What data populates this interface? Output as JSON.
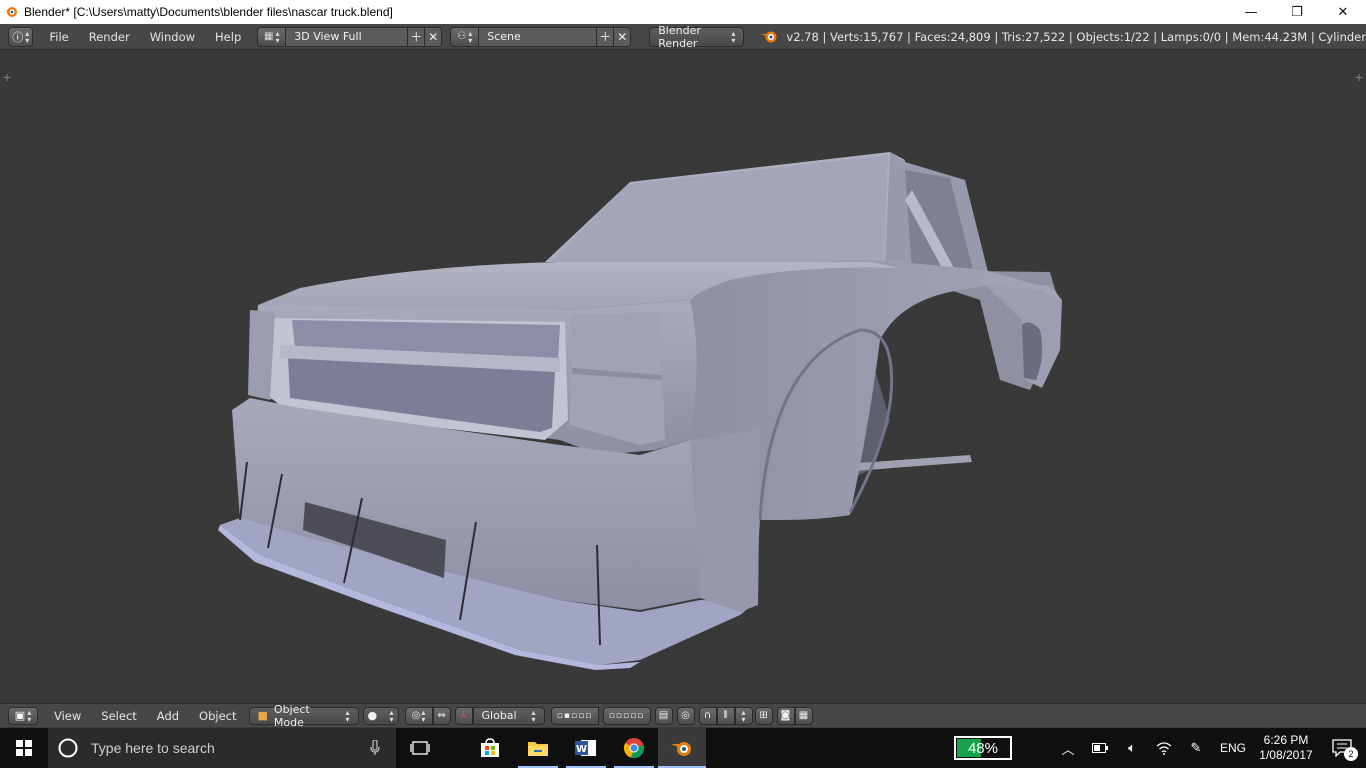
{
  "window": {
    "title": "Blender* [C:\\Users\\matty\\Documents\\blender files\\nascar truck.blend]",
    "minimize_glyph": "—",
    "restore_glyph": "❐",
    "close_glyph": "✕"
  },
  "info_header": {
    "editor_icon": "info-icon",
    "menus": [
      "File",
      "Render",
      "Window",
      "Help"
    ],
    "screen_layout": "3D View Full",
    "scene": "Scene",
    "render_engine": "Blender Render",
    "stats": "v2.78 | Verts:15,767 | Faces:24,809 | Tris:27,522 | Objects:1/22 | Lamps:0/0 | Mem:44.23M | Cylinder"
  },
  "view3d_header": {
    "menus": [
      "View",
      "Select",
      "Add",
      "Object"
    ],
    "mode": "Object Mode",
    "transform_orientation": "Global"
  },
  "taskbar": {
    "search_placeholder": "Type here to search",
    "battery_percent": "48%",
    "battery_level": 0.48,
    "language": "ENG",
    "time": "6:26 PM",
    "date": "1/08/2017",
    "notification_count": "2"
  },
  "colors": {
    "viewport_bg": "#393939",
    "header_bg": "#474747",
    "mesh_light": "#b4b6c8",
    "mesh_mid": "#9497ad",
    "mesh_dark": "#6d6f82",
    "battery_green": "#16a34a",
    "blender_orange": "#e87d0d"
  }
}
